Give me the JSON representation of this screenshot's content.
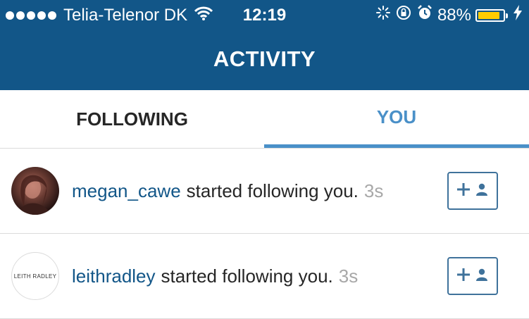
{
  "status_bar": {
    "carrier": "Telia-Telenor DK",
    "time": "12:19",
    "battery_percent": "88%",
    "battery_level": 0.88,
    "icons": [
      "signal-dots-icon",
      "wifi-icon",
      "activity-spinner-icon",
      "orientation-lock-icon",
      "alarm-icon",
      "battery-icon",
      "charging-bolt-icon"
    ]
  },
  "header": {
    "title": "ACTIVITY"
  },
  "tabs": [
    {
      "label": "FOLLOWING",
      "active": false
    },
    {
      "label": "YOU",
      "active": true
    }
  ],
  "activity": [
    {
      "username": "megan_cawe",
      "action": "started following you.",
      "time": "3s",
      "avatar": "photo"
    },
    {
      "username": "leithradley",
      "action": "started following you.",
      "time": "3s",
      "avatar_text": "LEITH RADLEY"
    }
  ],
  "colors": {
    "header_bg": "#125688",
    "accent": "#4a90c8",
    "username": "#125688",
    "battery": "#ffcc00"
  }
}
